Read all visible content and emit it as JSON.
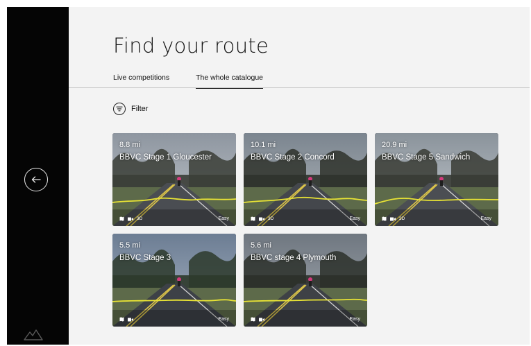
{
  "page": {
    "title": "Find your route"
  },
  "tabs": [
    {
      "label": "Live competitions"
    },
    {
      "label": "The whole catalogue"
    }
  ],
  "filter": {
    "label": "Filter"
  },
  "routes": [
    {
      "distance": "8.8 mi",
      "name": "BBVC Stage 1 Gloucester",
      "difficulty": "Easy",
      "tag_3d": "3D"
    },
    {
      "distance": "10.1 mi",
      "name": "BBVC Stage 2 Concord",
      "difficulty": "Easy",
      "tag_3d": "3D"
    },
    {
      "distance": "20.9 mi",
      "name": "BBVC Stage 5 Sandwich",
      "difficulty": "Easy",
      "tag_3d": "3D"
    },
    {
      "distance": "5.5 mi",
      "name": "BBVC Stage 3",
      "difficulty": "Easy"
    },
    {
      "distance": "5.6 mi",
      "name": "BBVC stage 4 Plymouth",
      "difficulty": "Easy"
    }
  ],
  "icons": {
    "back": "arrow-left-icon",
    "filter": "filter-icon",
    "logo": "mountain-logo-icon",
    "map": "map-icon",
    "video": "video-icon"
  },
  "colors": {
    "sidebar": "#050505",
    "background": "#f3f3f3",
    "elevation_line": "#e8e335",
    "text": "#111111"
  }
}
